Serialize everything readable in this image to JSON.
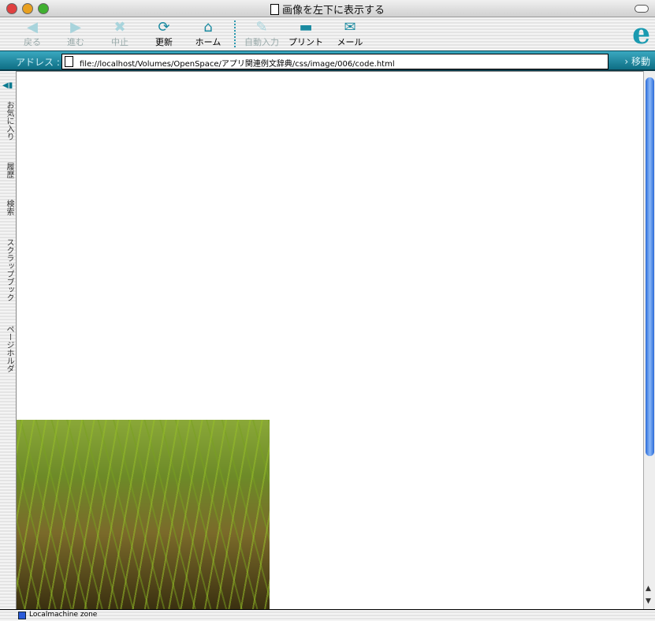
{
  "window": {
    "title": "画像を左下に表示する"
  },
  "toolbar": {
    "back": "戻る",
    "forward": "進む",
    "stop": "中止",
    "refresh": "更新",
    "home": "ホーム",
    "autofill": "自動入力",
    "print": "プリント",
    "mail": "メール"
  },
  "address": {
    "label": "アドレス :",
    "url": "file://localhost/Volumes/OpenSpace/アプリ関連例文辞典/css/image/006/code.html",
    "go": "移動"
  },
  "sidebar": {
    "tabs": [
      "お気に入り",
      "履歴",
      "検索",
      "スクラップブック",
      "ページホルダ"
    ]
  },
  "status": {
    "zone": "Localmachine zone"
  }
}
